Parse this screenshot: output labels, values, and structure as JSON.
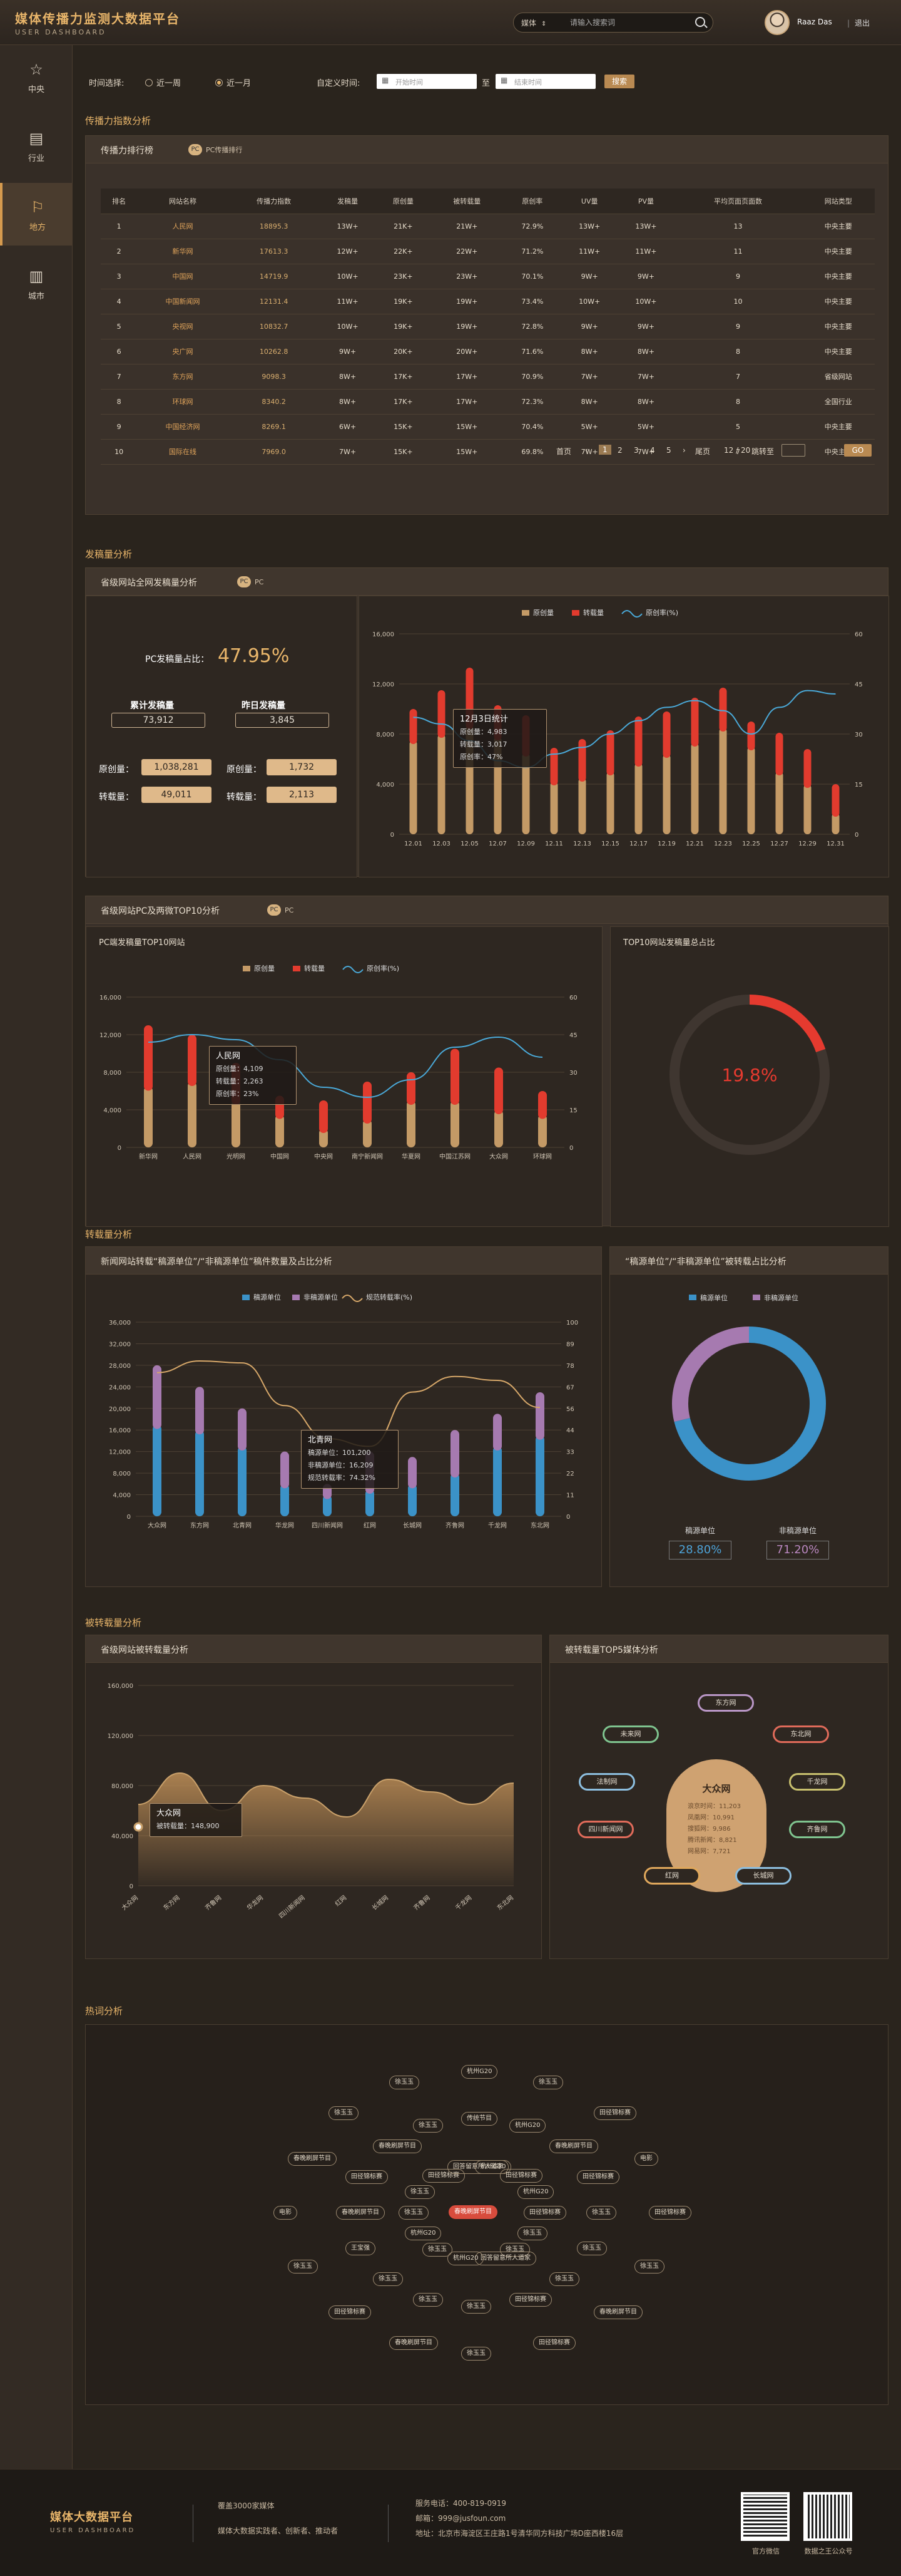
{
  "header": {
    "title": "媒体传播力监测大数据平台",
    "subtitle": "USER DASHBOARD",
    "search_type": "媒体",
    "search_placeholder": "请输入搜索词",
    "user_name": "Raaz Das",
    "logout": "退出"
  },
  "nav": [
    {
      "label": "中央",
      "icon": "star-icon"
    },
    {
      "label": "行业",
      "icon": "archive-icon"
    },
    {
      "label": "地方",
      "icon": "flag-icon"
    },
    {
      "label": "城市",
      "icon": "city-icon"
    }
  ],
  "filters": {
    "time_label": "时间选择:",
    "opt_week": "近一周",
    "opt_month": "近一月",
    "custom_label": "自定义时间:",
    "start_ph": "开始时间",
    "to": "至",
    "end_ph": "结束时间",
    "search_btn": "搜索"
  },
  "sections": {
    "spread": "传播力指数分析",
    "publish": "发稿量分析",
    "repost": "转载量分析",
    "reposted": "被转载量分析",
    "hotword": "热词分析"
  },
  "ranking": {
    "title": "传播力排行榜",
    "tag": "PC传播排行",
    "headers": [
      "排名",
      "网站名称",
      "传播力指数",
      "发稿量",
      "原创量",
      "被转载量",
      "原创率",
      "UV量",
      "PV量",
      "平均页面页面数",
      "网站类型"
    ],
    "rows": [
      [
        "1",
        "人民网",
        "18895.3",
        "13W+",
        "21K+",
        "21W+",
        "72.9%",
        "13W+",
        "13W+",
        "13",
        "中央主要"
      ],
      [
        "2",
        "新华网",
        "17613.3",
        "12W+",
        "22K+",
        "22W+",
        "71.2%",
        "11W+",
        "11W+",
        "11",
        "中央主要"
      ],
      [
        "3",
        "中国网",
        "14719.9",
        "10W+",
        "23K+",
        "23W+",
        "70.1%",
        "9W+",
        "9W+",
        "9",
        "中央主要"
      ],
      [
        "4",
        "中国新闻网",
        "12131.4",
        "11W+",
        "19K+",
        "19W+",
        "73.4%",
        "10W+",
        "10W+",
        "10",
        "中央主要"
      ],
      [
        "5",
        "央视网",
        "10832.7",
        "10W+",
        "19K+",
        "19W+",
        "72.8%",
        "9W+",
        "9W+",
        "9",
        "中央主要"
      ],
      [
        "6",
        "央广网",
        "10262.8",
        "9W+",
        "20K+",
        "20W+",
        "71.6%",
        "8W+",
        "8W+",
        "8",
        "中央主要"
      ],
      [
        "7",
        "东方网",
        "9098.3",
        "8W+",
        "17K+",
        "17W+",
        "70.9%",
        "7W+",
        "7W+",
        "7",
        "省级网站"
      ],
      [
        "8",
        "环球网",
        "8340.2",
        "8W+",
        "17K+",
        "17W+",
        "72.3%",
        "8W+",
        "8W+",
        "8",
        "全国行业"
      ],
      [
        "9",
        "中国经济网",
        "8269.1",
        "6W+",
        "15K+",
        "15W+",
        "70.4%",
        "5W+",
        "5W+",
        "5",
        "中央主要"
      ],
      [
        "10",
        "国际在线",
        "7969.0",
        "7W+",
        "15K+",
        "15W+",
        "69.8%",
        "7W+",
        "7W+",
        "7",
        "中央主要"
      ]
    ]
  },
  "pager": {
    "first": "首页",
    "prev": "‹",
    "pages": [
      "1",
      "2",
      "3",
      "4",
      "5"
    ],
    "next": "›",
    "last": "尾页",
    "count": "12 / 20",
    "jump": "跳转至",
    "go": "GO"
  },
  "publish_panel": {
    "title": "省级网站全网发稿量分析",
    "tag": "PC",
    "ratio_label": "PC发稿量占比：",
    "ratio": "47.95%",
    "total_label": "累计发稿量",
    "total": "73,912",
    "yesterday_label": "昨日发稿量",
    "yesterday": "3,845",
    "orig1_label": "原创量：",
    "orig1": "1,038,281",
    "orig2_label": "原创量：",
    "orig2": "1,732",
    "rep1_label": "转载量：",
    "rep1": "49,011",
    "rep2_label": "转载量：",
    "rep2": "2,113",
    "tooltip": {
      "title": "12月3日统计",
      "l1": "原创量：4,983",
      "l2": "转载量：3,017",
      "l3": "原创率：47%"
    }
  },
  "top10_panel": {
    "title": "省级网站PC及两微TOP10分析",
    "tag": "PC",
    "chart_title": "PC端发稿量TOP10网站",
    "share_title": "TOP10网站发稿量总占比",
    "share": "19.8%",
    "tooltip": {
      "title": "人民网",
      "l1": "原创量：4,109",
      "l2": "转载量：2,263",
      "l3": "原创率：23%"
    }
  },
  "repost_panel": {
    "bar_title": "新闻网站转载“稿源单位”/“非稿源单位”稿件数量及占比分析",
    "donut_title": "“稿源单位”/“非稿源单位”被转载占比分析",
    "tooltip": {
      "title": "北青网",
      "l1": "稿源单位：101,200",
      "l2": "非稿源单位：16,209",
      "l3": "规范转载率：74.32%"
    },
    "src_label": "稿源单位",
    "src_val": "28.80%",
    "nonsrc_label": "非稿源单位",
    "nonsrc_val": "71.20%"
  },
  "reposted_panel": {
    "area_title": "省级网站被转载量分析",
    "top5_title": "被转载量TOP5媒体分析",
    "tooltip": {
      "title": "大众网",
      "l1": "被转载量：148,900"
    },
    "center": {
      "name": "大众网",
      "lines": [
        "浪京时间：11,203",
        "凤凰网：10,991",
        "搜狐网：9,986",
        "腾讯新闻：8,821",
        "网易网：7,721"
      ]
    },
    "pills": [
      "东方网",
      "未来网",
      "东北网",
      "法制网",
      "千龙网",
      "四川新闻网",
      "齐鲁网",
      "红网",
      "长城网"
    ]
  },
  "hotwords": {
    "hot": "春晚刷屏节目",
    "words": [
      "田径锦标赛",
      "徐玉玉",
      "徐玉玉",
      "回答留意所人道家",
      "杭州G20",
      "徐玉玉",
      "杭州G20",
      "徐玉玉",
      "徐玉玉",
      "田径锦标赛",
      "回答留意所人道家",
      "杭州G20",
      "田径锦标赛",
      "杭州G20",
      "徐玉玉",
      "徐玉玉",
      "徐玉玉",
      "田径锦标赛",
      "徐玉玉",
      "徐玉玉",
      "徐玉玉",
      "王宝强",
      "春晚刷屏节目",
      "田径锦标赛",
      "春晚刷屏节目",
      "徐玉玉",
      "传统节目",
      "杭州G20",
      "春晚刷屏节目",
      "田径锦标赛",
      "田径锦标赛",
      "徐玉玉",
      "春晚刷屏节目",
      "田径锦标赛",
      "徐玉玉",
      "春晚刷屏节目",
      "田径锦标赛",
      "徐玉玉",
      "电影",
      "春晚刷屏节目",
      "徐玉玉",
      "徐玉玉",
      "杭州G20",
      "徐玉玉",
      "田径锦标赛",
      "电影"
    ]
  },
  "chart_data": [
    {
      "type": "bar",
      "title": "",
      "categories": [
        "12.01",
        "12.03",
        "12.05",
        "12.07",
        "12.09",
        "12.11",
        "12.13",
        "12.15",
        "12.17",
        "12.19",
        "12.21",
        "12.23",
        "12.25",
        "12.27",
        "12.29",
        "12.31"
      ],
      "series": [
        {
          "name": "原创量",
          "values": [
            7500,
            8000,
            8700,
            7800,
            6500,
            4200,
            4500,
            5000,
            5700,
            6400,
            7300,
            8500,
            7000,
            5000,
            4000,
            1700
          ]
        },
        {
          "name": "转载量",
          "values": [
            2500,
            3500,
            4600,
            2500,
            3000,
            2700,
            3100,
            3300,
            3700,
            3400,
            3600,
            3200,
            2000,
            3100,
            2800,
            2300
          ]
        },
        {
          "name": "原创率(%)",
          "values": [
            35,
            33,
            28,
            22,
            20,
            24,
            26,
            30,
            34,
            38,
            40,
            37,
            30,
            38,
            43,
            42
          ]
        }
      ],
      "ylim": [
        0,
        16000
      ],
      "y2lim": [
        0,
        60
      ]
    },
    {
      "type": "bar",
      "title": "",
      "categories": [
        "新华网",
        "人民网",
        "光明网",
        "中国网",
        "中央网",
        "南宁新闻网",
        "华夏网",
        "中国江苏网",
        "大众网",
        "环球网"
      ],
      "series": [
        {
          "name": "原创量",
          "values": [
            6500,
            7000,
            5000,
            3500,
            2000,
            3000,
            5000,
            5000,
            4000,
            3500
          ]
        },
        {
          "name": "转载量",
          "values": [
            6500,
            5000,
            4000,
            2000,
            3000,
            4000,
            3000,
            5500,
            4500,
            2500
          ]
        },
        {
          "name": "原创率(%)",
          "values": [
            42,
            45,
            43,
            35,
            24,
            20,
            27,
            40,
            44,
            36
          ]
        }
      ],
      "ylim": [
        0,
        16000
      ],
      "y2lim": [
        0,
        60
      ]
    },
    {
      "type": "pie",
      "title": "",
      "values": [
        19.8,
        80.2
      ]
    },
    {
      "type": "bar",
      "title": "",
      "categories": [
        "大众网",
        "东方网",
        "北青网",
        "华龙网",
        "四川新闻网",
        "红网",
        "长城网",
        "齐鲁网",
        "千龙网",
        "东北网"
      ],
      "series": [
        {
          "name": "稿源单位",
          "values": [
            17000,
            16000,
            13000,
            6000,
            4000,
            5000,
            6000,
            8000,
            13000,
            15000
          ]
        },
        {
          "name": "非稿源单位",
          "values": [
            11000,
            8000,
            7000,
            6000,
            2000,
            7000,
            5000,
            8000,
            6000,
            8000
          ]
        },
        {
          "name": "规范转载率(%)",
          "values": [
            74,
            80,
            79,
            57,
            40,
            36,
            64,
            72,
            70,
            56
          ]
        }
      ],
      "ylim": [
        0,
        36000
      ],
      "y2lim": [
        0,
        100
      ]
    },
    {
      "type": "pie",
      "title": "",
      "categories": [
        "稿源单位",
        "非稿源单位"
      ],
      "values": [
        28.8,
        71.2
      ]
    },
    {
      "type": "area",
      "title": "",
      "categories": [
        "大众网",
        "东方网",
        "齐鲁网",
        "华龙网",
        "四川新闻网",
        "红网",
        "长城网",
        "齐鲁网",
        "千龙网",
        "东北网"
      ],
      "values": [
        65000,
        90000,
        60000,
        80000,
        70000,
        55000,
        85000,
        75000,
        65000,
        82000
      ],
      "ylim": [
        0,
        160000
      ]
    }
  ],
  "footer": {
    "brand": "媒体大数据平台",
    "brand_en": "USER DASHBOARD",
    "l1": "覆盖3000家媒体",
    "l2": "媒体大数据实践者、创新者、推动者",
    "phone": "服务电话：400-819-0919",
    "mail": "邮箱：999@jusfoun.com",
    "addr": "地址：北京市海淀区王庄路1号清华同方科技广场D座西楼16层",
    "qr1": "官方微信",
    "qr2": "数据之王公众号"
  }
}
